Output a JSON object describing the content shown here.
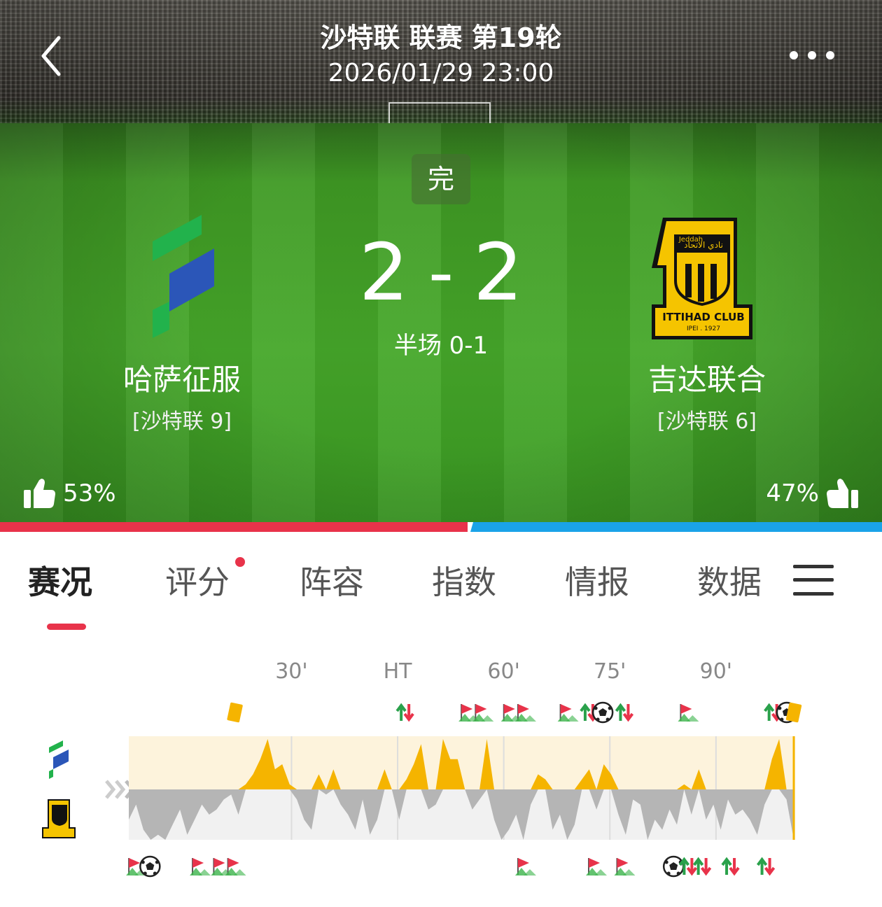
{
  "header": {
    "league_title": "沙特联 联赛 第19轮",
    "match_time": "2026/01/29 23:00"
  },
  "match": {
    "status": "完",
    "home_score": "2",
    "away_score": "2",
    "dash": "-",
    "halftime": "半场 0-1"
  },
  "home": {
    "name": "哈萨征服",
    "rank": "[沙特联 9]",
    "vote": "53%"
  },
  "away": {
    "name": "吉达联合",
    "rank": "[沙特联 6]",
    "vote": "47%",
    "logo_text": "ITTIHAD CLUB",
    "logo_year": "IPEI . 1927",
    "logo_arabic": "نادي الاتحاد",
    "logo_city": "Jeddah"
  },
  "vote_share": {
    "home": 0.53,
    "away": 0.47
  },
  "colors": {
    "home_bar": "#e8334a",
    "away_bar": "#1aa3e8",
    "accent": "#e8334a",
    "momentum_home": "#f5b400",
    "momentum_away": "#b5b5b5"
  },
  "tabs": [
    {
      "label": "赛况",
      "active": true
    },
    {
      "label": "评分",
      "badge": true
    },
    {
      "label": "阵容"
    },
    {
      "label": "指数"
    },
    {
      "label": "情报"
    },
    {
      "label": "数据"
    }
  ],
  "timeline": {
    "markers": [
      "30'",
      "HT",
      "60'",
      "75'",
      "90'"
    ],
    "marker_minutes": [
      30,
      45,
      60,
      75,
      90
    ],
    "minute_range": [
      7,
      101
    ],
    "home_events": [
      {
        "type": "yellow-card",
        "minute": 22
      },
      {
        "type": "substitution",
        "minute": 46
      },
      {
        "type": "corner",
        "minute": 55
      },
      {
        "type": "corner",
        "minute": 57
      },
      {
        "type": "corner",
        "minute": 61
      },
      {
        "type": "corner",
        "minute": 63
      },
      {
        "type": "corner",
        "minute": 69
      },
      {
        "type": "substitution",
        "minute": 72
      },
      {
        "type": "goal",
        "minute": 74
      },
      {
        "type": "substitution",
        "minute": 77
      },
      {
        "type": "corner",
        "minute": 86
      },
      {
        "type": "substitution",
        "minute": 98
      },
      {
        "type": "goal",
        "minute": 100
      },
      {
        "type": "yellow-card",
        "minute": 101
      }
    ],
    "away_events": [
      {
        "type": "corner",
        "minute": 8
      },
      {
        "type": "goal",
        "minute": 10
      },
      {
        "type": "corner",
        "minute": 17
      },
      {
        "type": "corner",
        "minute": 20
      },
      {
        "type": "corner",
        "minute": 22
      },
      {
        "type": "corner",
        "minute": 63
      },
      {
        "type": "corner",
        "minute": 73
      },
      {
        "type": "corner",
        "minute": 77
      },
      {
        "type": "goal",
        "minute": 84
      },
      {
        "type": "substitution",
        "minute": 86
      },
      {
        "type": "substitution",
        "minute": 88
      },
      {
        "type": "substitution",
        "minute": 92
      },
      {
        "type": "substitution",
        "minute": 97
      }
    ],
    "momentum": [
      -0.6,
      -0.3,
      -0.8,
      -1.0,
      -0.9,
      -1.0,
      -0.7,
      -0.4,
      -0.9,
      -0.6,
      -0.3,
      -0.5,
      -0.4,
      -0.2,
      -0.1,
      -0.5,
      0.1,
      0.3,
      0.6,
      1.0,
      0.4,
      0.5,
      0.1,
      -0.2,
      -0.6,
      -0.8,
      0.3,
      -0.1,
      0.4,
      -0.3,
      -0.5,
      -0.8,
      -0.2,
      -0.9,
      -0.6,
      0.4,
      0.0,
      -0.6,
      0.2,
      0.5,
      0.9,
      -0.4,
      -0.3,
      1.0,
      0.6,
      0.6,
      0.0,
      -0.4,
      -0.2,
      1.0,
      -0.6,
      -1.0,
      -0.8,
      -0.5,
      -1.0,
      -0.3,
      0.3,
      0.2,
      -0.8,
      -0.5,
      -1.0,
      -0.7,
      0.2,
      0.4,
      -0.4,
      0.5,
      0.3,
      -0.5,
      -0.9,
      -0.2,
      -0.3,
      -1.0,
      -0.6,
      -0.8,
      -0.4,
      -0.7,
      0.1,
      -0.5,
      0.4,
      -0.6,
      -0.3,
      -0.8,
      -0.2,
      -0.5,
      -0.4,
      -0.6,
      -0.9,
      -0.3,
      0.6,
      1.0,
      -0.2,
      -1.0
    ]
  }
}
